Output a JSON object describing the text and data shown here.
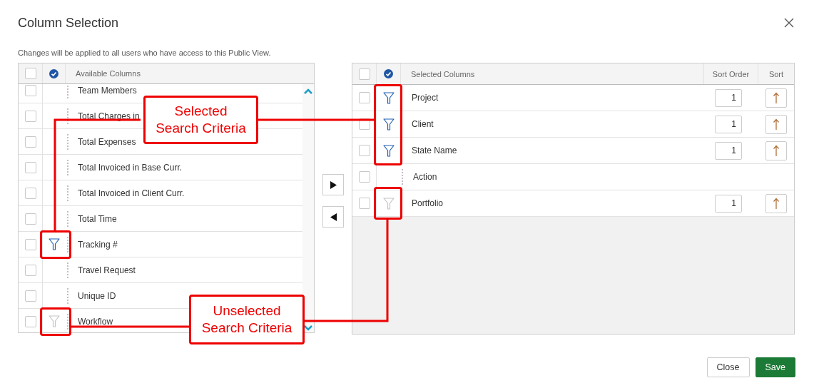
{
  "window": {
    "title": "Column Selection"
  },
  "note": "Changes will be applied to all users who have access to this Public View.",
  "available": {
    "header": "Available Columns",
    "all_checked": false,
    "rows": [
      {
        "label": "Team Members",
        "checked": false,
        "has_filter": false
      },
      {
        "label": "Total Charges in",
        "checked": false,
        "has_filter": false
      },
      {
        "label": "Total Expenses",
        "checked": false,
        "has_filter": false
      },
      {
        "label": "Total Invoiced in Base Curr.",
        "checked": false,
        "has_filter": false
      },
      {
        "label": "Total Invoiced in Client Curr.",
        "checked": false,
        "has_filter": false
      },
      {
        "label": "Total Time",
        "checked": false,
        "has_filter": false
      },
      {
        "label": "Tracking #",
        "checked": false,
        "has_filter": true,
        "filter_active": true
      },
      {
        "label": "Travel Request",
        "checked": false,
        "has_filter": false
      },
      {
        "label": "Unique ID",
        "checked": false,
        "has_filter": false
      },
      {
        "label": "Workflow",
        "checked": false,
        "has_filter": true,
        "filter_active": false
      }
    ]
  },
  "selected_columns": {
    "headers": [
      "Selected Columns",
      "Sort Order",
      "Sort"
    ],
    "all_checked": false,
    "rows": [
      {
        "label": "Project",
        "checked": false,
        "has_filter": true,
        "filter_active": true,
        "sort_order": "1"
      },
      {
        "label": "Client",
        "checked": false,
        "has_filter": true,
        "filter_active": true,
        "sort_order": "1"
      },
      {
        "label": "State Name",
        "checked": false,
        "has_filter": true,
        "filter_active": true,
        "sort_order": "1"
      },
      {
        "label": "Action",
        "checked": false,
        "has_filter": false
      },
      {
        "label": "Portfolio",
        "checked": false,
        "has_filter": true,
        "filter_active": false,
        "sort_order": "1"
      }
    ]
  },
  "buttons": [
    "Close",
    "Save"
  ],
  "annotations": [
    {
      "text": "Selected Search Criteria"
    },
    {
      "text": "Unselected Search Criteria"
    }
  ]
}
